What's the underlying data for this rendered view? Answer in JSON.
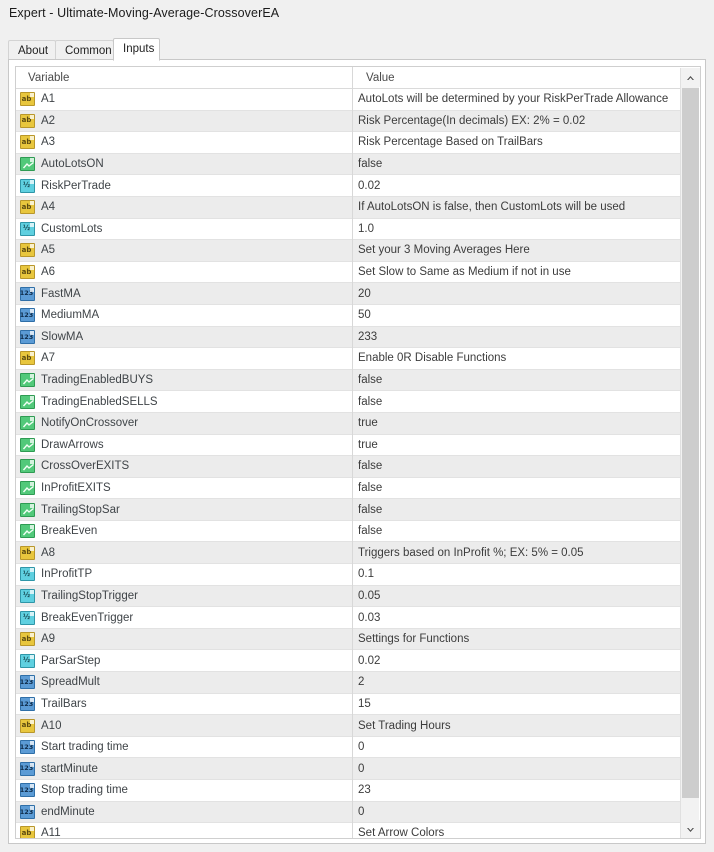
{
  "window": {
    "title": "Expert - Ultimate-Moving-Average-CrossoverEA"
  },
  "tabs": [
    {
      "label": "About",
      "active": false
    },
    {
      "label": "Common",
      "active": false
    },
    {
      "label": "Inputs",
      "active": true
    }
  ],
  "grid": {
    "columns": {
      "variable": "Variable",
      "value": "Value"
    },
    "rows": [
      {
        "icon": "string-type-icon",
        "type": "string",
        "variable": "A1",
        "value": "AutoLots will be determined by your RiskPerTrade Allowance"
      },
      {
        "icon": "string-type-icon",
        "type": "string",
        "variable": "A2",
        "value": "Risk Percentage(In decimals) EX: 2% = 0.02"
      },
      {
        "icon": "string-type-icon",
        "type": "string",
        "variable": "A3",
        "value": "Risk Percentage Based on TrailBars"
      },
      {
        "icon": "bool-type-icon",
        "type": "bool",
        "variable": "AutoLotsON",
        "value": "false"
      },
      {
        "icon": "double-type-icon",
        "type": "double",
        "variable": "RiskPerTrade",
        "value": "0.02"
      },
      {
        "icon": "string-type-icon",
        "type": "string",
        "variable": "A4",
        "value": "If AutoLotsON is false, then CustomLots will be used"
      },
      {
        "icon": "double-type-icon",
        "type": "double",
        "variable": "CustomLots",
        "value": "1.0"
      },
      {
        "icon": "string-type-icon",
        "type": "string",
        "variable": "A5",
        "value": "Set your 3 Moving Averages Here"
      },
      {
        "icon": "string-type-icon",
        "type": "string",
        "variable": "A6",
        "value": "Set Slow to Same as Medium if not in use"
      },
      {
        "icon": "int-type-icon",
        "type": "int",
        "variable": "FastMA",
        "value": "20"
      },
      {
        "icon": "int-type-icon",
        "type": "int",
        "variable": "MediumMA",
        "value": "50"
      },
      {
        "icon": "int-type-icon",
        "type": "int",
        "variable": "SlowMA",
        "value": "233"
      },
      {
        "icon": "string-type-icon",
        "type": "string",
        "variable": "A7",
        "value": "Enable 0R Disable Functions"
      },
      {
        "icon": "bool-type-icon",
        "type": "bool",
        "variable": "TradingEnabledBUYS",
        "value": "false"
      },
      {
        "icon": "bool-type-icon",
        "type": "bool",
        "variable": "TradingEnabledSELLS",
        "value": "false"
      },
      {
        "icon": "bool-type-icon",
        "type": "bool",
        "variable": "NotifyOnCrossover",
        "value": "true"
      },
      {
        "icon": "bool-type-icon",
        "type": "bool",
        "variable": "DrawArrows",
        "value": "true"
      },
      {
        "icon": "bool-type-icon",
        "type": "bool",
        "variable": "CrossOverEXITS",
        "value": "false"
      },
      {
        "icon": "bool-type-icon",
        "type": "bool",
        "variable": "InProfitEXITS",
        "value": "false"
      },
      {
        "icon": "bool-type-icon",
        "type": "bool",
        "variable": "TrailingStopSar",
        "value": "false"
      },
      {
        "icon": "bool-type-icon",
        "type": "bool",
        "variable": "BreakEven",
        "value": "false"
      },
      {
        "icon": "string-type-icon",
        "type": "string",
        "variable": "A8",
        "value": "Triggers based on InProfit %; EX: 5% = 0.05"
      },
      {
        "icon": "double-type-icon",
        "type": "double",
        "variable": "InProfitTP",
        "value": "0.1"
      },
      {
        "icon": "double-type-icon",
        "type": "double",
        "variable": "TrailingStopTrigger",
        "value": "0.05"
      },
      {
        "icon": "double-type-icon",
        "type": "double",
        "variable": "BreakEvenTrigger",
        "value": "0.03"
      },
      {
        "icon": "string-type-icon",
        "type": "string",
        "variable": "A9",
        "value": "Settings for Functions"
      },
      {
        "icon": "double-type-icon",
        "type": "double",
        "variable": "ParSarStep",
        "value": "0.02"
      },
      {
        "icon": "int-type-icon",
        "type": "int",
        "variable": "SpreadMult",
        "value": "2"
      },
      {
        "icon": "int-type-icon",
        "type": "int",
        "variable": "TrailBars",
        "value": "15"
      },
      {
        "icon": "string-type-icon",
        "type": "string",
        "variable": "A10",
        "value": "Set Trading Hours"
      },
      {
        "icon": "int-type-icon",
        "type": "int",
        "variable": "Start trading time",
        "value": "0"
      },
      {
        "icon": "int-type-icon",
        "type": "int",
        "variable": "startMinute",
        "value": "0"
      },
      {
        "icon": "int-type-icon",
        "type": "int",
        "variable": "Stop trading time",
        "value": "23"
      },
      {
        "icon": "int-type-icon",
        "type": "int",
        "variable": "endMinute",
        "value": "0"
      },
      {
        "icon": "string-type-icon",
        "type": "string",
        "variable": "A11",
        "value": "Set Arrow Colors"
      }
    ]
  },
  "scrollbar": {
    "up_icon": "chevron-up-icon",
    "down_icon": "chevron-down-icon"
  },
  "type_glyphs": {
    "string": "ab",
    "double": "½",
    "int": "123"
  },
  "colors": {
    "string_icon": "#e8c63d",
    "bool_icon": "#52c97a",
    "double_icon": "#5fd0e0",
    "int_icon": "#5b9bd5",
    "row_alt": "#ececec",
    "window_bg": "#f0f0f0"
  }
}
